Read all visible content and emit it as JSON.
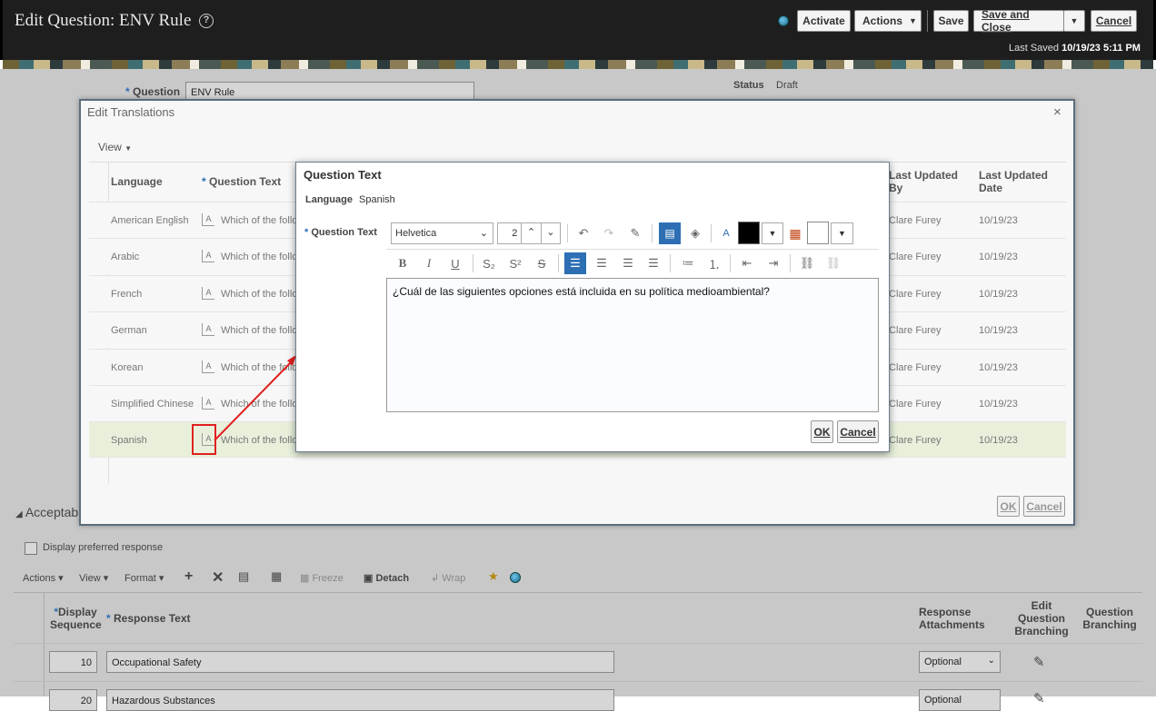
{
  "header": {
    "title": "Edit Question: ENV Rule",
    "help": "?",
    "activate": "Activate",
    "actions": "Actions",
    "save": "Save",
    "save_close": "Save and Close",
    "cancel": "Cancel",
    "last_saved_label": "Last Saved",
    "last_saved_value": "10/19/23 5:11 PM"
  },
  "form": {
    "question_label": "Question",
    "question_value": "ENV Rule",
    "status_label": "Status",
    "status_value": "Draft"
  },
  "translations": {
    "title": "Edit Translations",
    "view": "View",
    "col_language": "Language",
    "col_question_text": "Question Text",
    "col_last_updated_by": "Last Updated By",
    "col_last_updated_date": "Last Updated Date",
    "rows": [
      {
        "language": "American English",
        "text": "Which of the follo",
        "by": "Clare Furey",
        "date": "10/19/23"
      },
      {
        "language": "Arabic",
        "text": "Which of the follo",
        "by": "Clare Furey",
        "date": "10/19/23"
      },
      {
        "language": "French",
        "text": "Which of the follo",
        "by": "Clare Furey",
        "date": "10/19/23"
      },
      {
        "language": "German",
        "text": "Which of the follo",
        "by": "Clare Furey",
        "date": "10/19/23"
      },
      {
        "language": "Korean",
        "text": "Which of the follo",
        "by": "Clare Furey",
        "date": "10/19/23"
      },
      {
        "language": "Simplified Chinese",
        "text": "Which of the follo",
        "by": "Clare Furey",
        "date": "10/19/23"
      },
      {
        "language": "Spanish",
        "text": "Which of the follo",
        "by": "Clare Furey",
        "date": "10/19/23"
      }
    ],
    "ok": "OK",
    "cancel": "Cancel"
  },
  "qt_dialog": {
    "title": "Question Text",
    "language_label": "Language",
    "language_value": "Spanish",
    "field_label": "Question Text",
    "font": "Helvetica",
    "size": "2",
    "body": "¿Cuál de las siguientes opciones está incluida en su política medioambiental?",
    "ok": "OK",
    "cancel": "Cancel"
  },
  "responses": {
    "section": "Acceptab",
    "display_preferred": "Display preferred response",
    "toolbar": {
      "actions": "Actions",
      "view": "View",
      "format": "Format",
      "freeze": "Freeze",
      "detach": "Detach",
      "wrap": "Wrap"
    },
    "col_seq": "Display Sequence",
    "col_text": "Response Text",
    "col_attach": "Response Attachments",
    "col_edit_branch": "Edit Question Branching",
    "col_branch": "Question Branching",
    "rows": [
      {
        "seq": "10",
        "text": "Occupational Safety",
        "attach": "Optional"
      },
      {
        "seq": "20",
        "text": "Hazardous Substances",
        "attach": "Optional"
      }
    ]
  },
  "colors": {
    "accent": "#2e6fb4",
    "highlight": "#e8f0dc"
  }
}
